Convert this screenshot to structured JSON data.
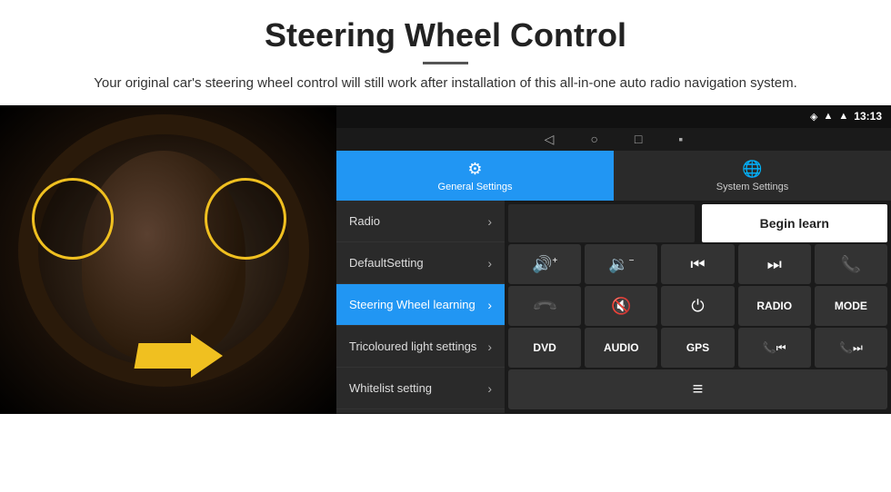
{
  "header": {
    "title": "Steering Wheel Control",
    "divider": true,
    "subtitle": "Your original car's steering wheel control will still work after installation of this all-in-one auto radio navigation system."
  },
  "statusBar": {
    "time": "13:13",
    "wifi_icon": "▲",
    "signal_icon": "▲",
    "battery_icon": "▪"
  },
  "navBar": {
    "back": "◁",
    "home": "○",
    "recent": "□",
    "cast": "▪"
  },
  "tabs": [
    {
      "label": "General Settings",
      "active": true
    },
    {
      "label": "System Settings",
      "active": false
    }
  ],
  "menu": [
    {
      "label": "Radio",
      "active": false
    },
    {
      "label": "DefaultSetting",
      "active": false
    },
    {
      "label": "Steering Wheel learning",
      "active": true
    },
    {
      "label": "Tricoloured light settings",
      "active": false
    },
    {
      "label": "Whitelist setting",
      "active": false
    }
  ],
  "buttons": {
    "begin_learn": "Begin learn",
    "vol_up": "🔊+",
    "vol_down": "🔉−",
    "prev_track": "⏮",
    "next_track": "⏭",
    "phone": "📞",
    "hang_up": "↩",
    "mute": "🔇×",
    "power": "⏻",
    "radio": "RADIO",
    "mode": "MODE",
    "dvd": "DVD",
    "audio": "AUDIO",
    "gps": "GPS",
    "phone_prev": "📞⏮",
    "phone_next": "📞⏭",
    "list_icon": "≡"
  }
}
